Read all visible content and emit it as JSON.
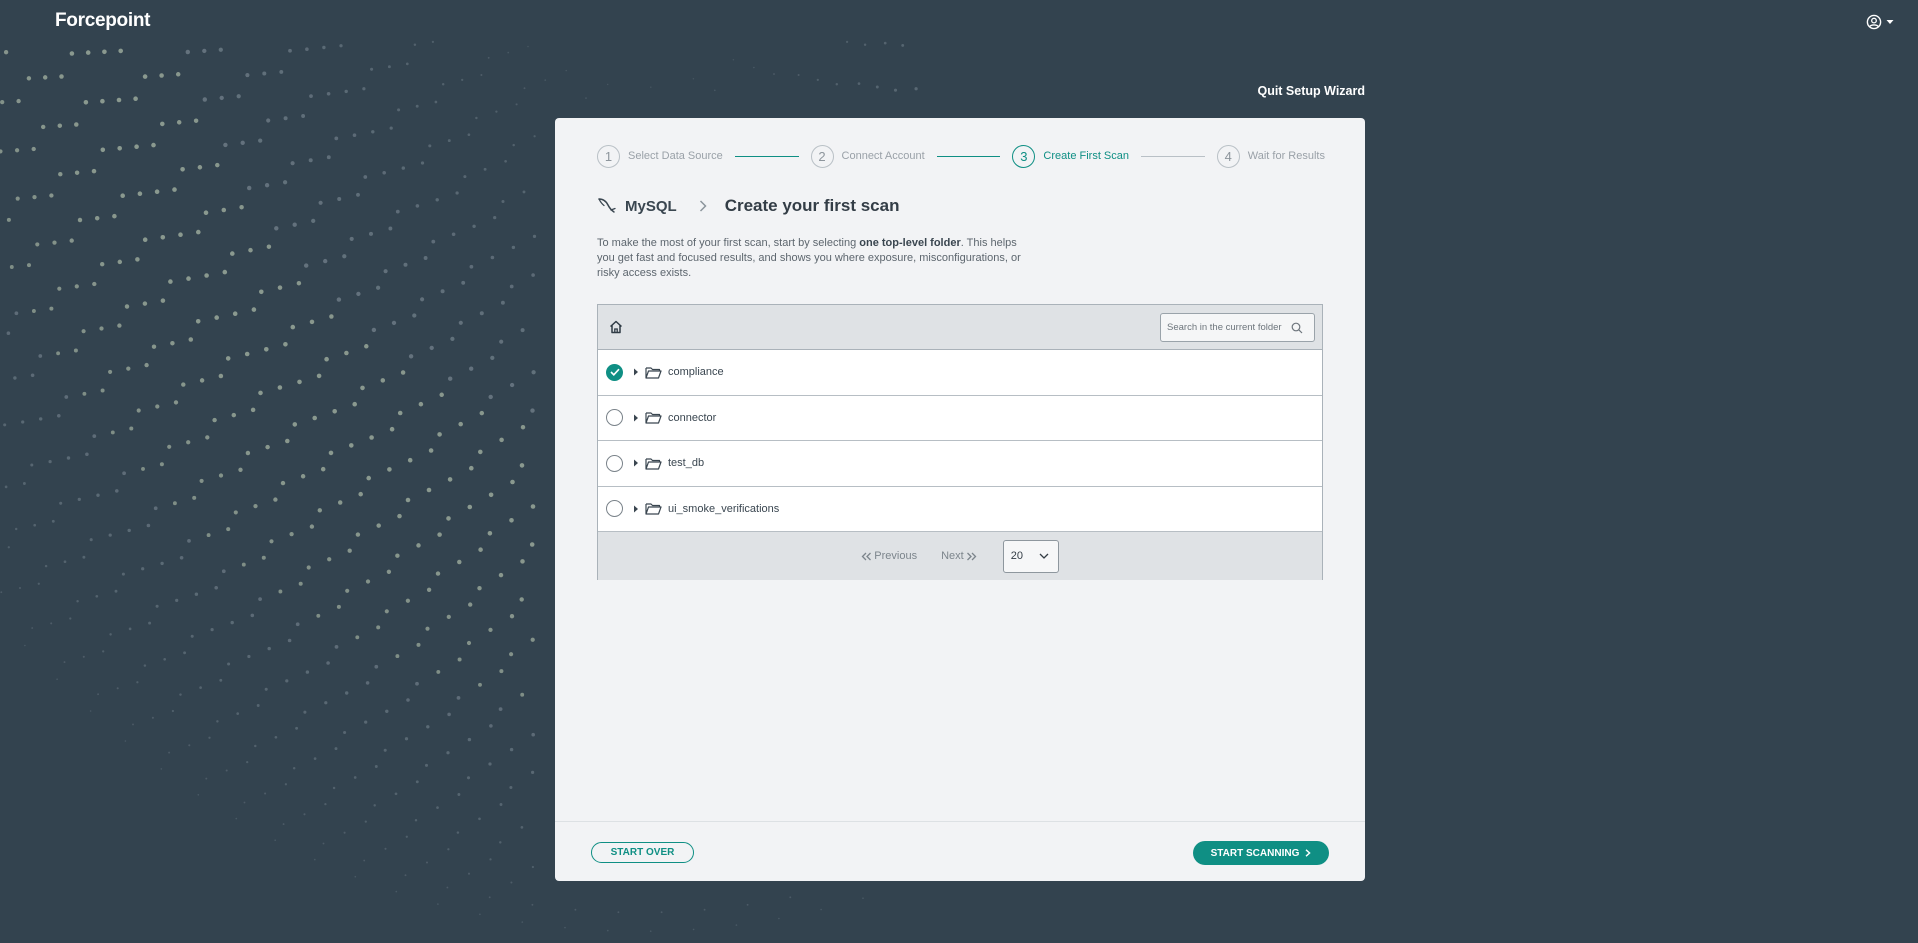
{
  "header": {
    "logo": "Forcepoint",
    "user_icon": "user-circle-icon"
  },
  "wizard": {
    "quit_label": "Quit Setup Wizard",
    "steps": [
      {
        "num": "1",
        "label": "Select Data Source"
      },
      {
        "num": "2",
        "label": "Connect Account"
      },
      {
        "num": "3",
        "label": "Create First Scan"
      },
      {
        "num": "4",
        "label": "Wait for Results"
      }
    ],
    "active_step": 3,
    "source": "MySQL",
    "source_icon": "mysql-dolphin-icon",
    "title": "Create your first scan",
    "intro_before": "To make the most of your first scan, start by selecting ",
    "intro_bold": "one top-level folder",
    "intro_after": ". This helps you get fast and focused results, and shows you where exposure, misconfigurations, or risky access exists."
  },
  "browser": {
    "search_placeholder": "Search in the current folder",
    "folders": [
      {
        "name": "compliance",
        "selected": true
      },
      {
        "name": "connector",
        "selected": false
      },
      {
        "name": "test_db",
        "selected": false
      },
      {
        "name": "ui_smoke_verifications",
        "selected": false
      }
    ],
    "pager": {
      "previous": "Previous",
      "next": "Next",
      "page_size": "20"
    }
  },
  "footer": {
    "start_over": "START OVER",
    "start_scanning": "START SCANNING"
  },
  "colors": {
    "background": "#33434f",
    "accent": "#0f8f84",
    "panel": "#f2f3f5"
  }
}
